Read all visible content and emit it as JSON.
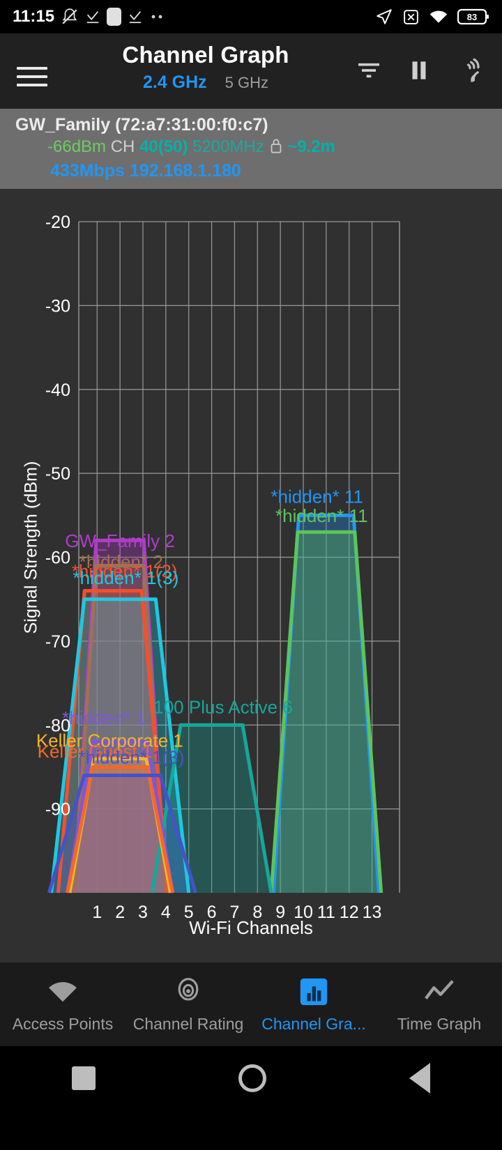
{
  "status_bar": {
    "time": "11:15",
    "icons_left": [
      "bell-mute-icon",
      "check-download-icon",
      "app-square-icon",
      "check-download-icon",
      "more-dots-icon"
    ],
    "icons_right": [
      "location-arrow-icon",
      "x-box-icon",
      "wifi-icon",
      "battery-icon"
    ],
    "battery_level": "83"
  },
  "app_bar": {
    "menu_icon": "hamburger-menu-icon",
    "title": "Channel Graph",
    "band_active": "2.4 GHz",
    "band_inactive": "5 GHz",
    "actions": [
      "filter-icon",
      "pause-icon",
      "scanner-icon"
    ]
  },
  "connection": {
    "ssid_line": "GW_Family (72:a7:31:00:f0:c7)",
    "signal": "-66dBm",
    "ch_label": "CH",
    "channel": "40(50)",
    "frequency": "5200MHz",
    "lock_icon": "lock-icon",
    "distance": "~9.2m",
    "link_speed": "433Mbps",
    "ip_address": "192.168.1.180"
  },
  "chart_data": {
    "type": "area",
    "title": "",
    "xlabel": "Wi-Fi Channels",
    "ylabel": "Signal Strength (dBm)",
    "xlim": [
      0.2,
      14.2
    ],
    "ylim": [
      -100,
      -20
    ],
    "yticks": [
      -20,
      -30,
      -40,
      -50,
      -60,
      -70,
      -80,
      -90
    ],
    "ytick_labels": [
      "-20",
      "-30",
      "-40",
      "-50",
      "-60",
      "-70",
      "-80",
      "-90"
    ],
    "xticks": [
      1,
      2,
      3,
      4,
      5,
      6,
      7,
      8,
      9,
      10,
      11,
      12,
      13
    ],
    "xtick_labels": [
      "1",
      "2",
      "3",
      "4",
      "5",
      "6",
      "7",
      "8",
      "9",
      "10",
      "11",
      "12",
      "13"
    ],
    "grid": true,
    "legend": "inline-labels",
    "series": [
      {
        "name": "GW_Family 2",
        "label": "GW_Family 2",
        "center": 2,
        "level": -58,
        "width": 2.0,
        "color": "#b03cc8",
        "label_x": 2.0,
        "label_y": -58.8
      },
      {
        "name": "*hidden* 2",
        "label": "*hidden* 2",
        "center": 2,
        "level": -61,
        "width": 2.0,
        "color": "#a07055",
        "label_x": 2.05,
        "label_y": -61.3
      },
      {
        "name": "*hidden* 1 (red)",
        "label": "*hidden* 1(3)",
        "center": 1.7,
        "level": -64,
        "width": 2.4,
        "color": "#f4502e",
        "label_x": 2.2,
        "label_y": -62.4
      },
      {
        "name": "*hidden* 1 (cyan)",
        "label": "*hidden* 1(3)",
        "center": 2.0,
        "level": -65,
        "width": 3.0,
        "color": "#1ec8e0",
        "label_x": 2.25,
        "label_y": -63.2
      },
      {
        "name": "*hidden* 11 (blue)",
        "label": "*hidden* 11",
        "center": 11,
        "level": -55,
        "width": 2.3,
        "color": "#2196f3",
        "label_x": 10.6,
        "label_y": -53.5
      },
      {
        "name": "*hidden* 11 (green)",
        "label": "*hidden* 11",
        "center": 11,
        "level": -57,
        "width": 2.4,
        "color": "#5cc45c",
        "label_x": 10.8,
        "label_y": -55.8
      },
      {
        "name": "100 Plus Active 6",
        "label": "100 Plus Active 6",
        "center": 6,
        "level": -80,
        "width": 2.6,
        "color": "#16a79a",
        "label_x": 6.5,
        "label_y": -78.6
      },
      {
        "name": "*hidden* 1 (purple)",
        "label": "*hidden* 1",
        "center": 2,
        "level": -82,
        "width": 2.3,
        "color": "#7e57d8",
        "label_x": 1.3,
        "label_y": -79.9
      },
      {
        "name": "Keller Corporate 1",
        "label": "Keller Corporate 1",
        "center": 2,
        "level": -84,
        "width": 2.2,
        "color": "#f2b52c",
        "label_x": 1.55,
        "label_y": -82.6
      },
      {
        "name": "Keller Guest 1",
        "label": "Keller Guest 1",
        "center": 2,
        "level": -85,
        "width": 2.3,
        "color": "#f2682a",
        "label_x": 0.9,
        "label_y": -83.9
      },
      {
        "name": "*hidden* 1(3) blue",
        "label": "*hidden* 1(3)",
        "center": 2.1,
        "level": -86,
        "width": 3.2,
        "color": "#4453c8",
        "label_x": 2.5,
        "label_y": -84.6
      }
    ]
  },
  "bottom_nav": {
    "items": [
      {
        "label": "Access Points",
        "icon": "wifi-icon",
        "active": false
      },
      {
        "label": "Channel Rating",
        "icon": "radar-icon",
        "active": false
      },
      {
        "label": "Channel Gra...",
        "icon": "bar-chart-icon",
        "active": true
      },
      {
        "label": "Time Graph",
        "icon": "line-chart-icon",
        "active": false
      }
    ],
    "accent_color": "#2196f3"
  },
  "system_nav": {
    "recents": "square-icon",
    "home": "circle-icon",
    "back": "triangle-back-icon"
  }
}
